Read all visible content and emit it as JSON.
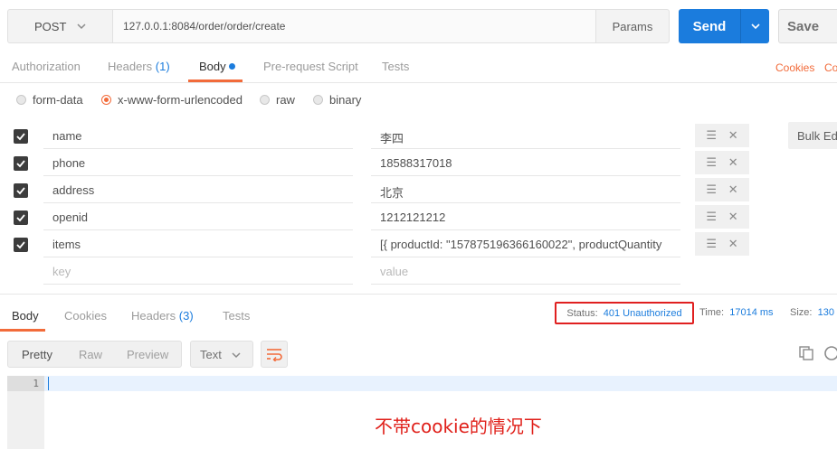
{
  "request": {
    "method": "POST",
    "url": "127.0.0.1:8084/order/order/create",
    "params_label": "Params",
    "send_label": "Send",
    "save_label": "Save"
  },
  "request_tabs": {
    "authorization": "Authorization",
    "headers": "Headers",
    "headers_count": "(1)",
    "body": "Body",
    "prerequest": "Pre-request Script",
    "tests": "Tests",
    "cookies": "Cookies",
    "code": "Co"
  },
  "body_types": [
    "form-data",
    "x-www-form-urlencoded",
    "raw",
    "binary"
  ],
  "body_type_selected": "x-www-form-urlencoded",
  "form_rows": [
    {
      "checked": true,
      "key": "name",
      "value": "李四"
    },
    {
      "checked": true,
      "key": "phone",
      "value": "18588317018"
    },
    {
      "checked": true,
      "key": "address",
      "value": "北京"
    },
    {
      "checked": true,
      "key": "openid",
      "value": "1212121212"
    },
    {
      "checked": true,
      "key": "items",
      "value": "[{ productId: \"157875196366160022\", productQuantity"
    }
  ],
  "new_row": {
    "key_placeholder": "key",
    "value_placeholder": "value"
  },
  "bulk_edit_label": "Bulk Edi",
  "response_tabs": {
    "body": "Body",
    "cookies": "Cookies",
    "headers": "Headers",
    "headers_count": "(3)",
    "tests": "Tests"
  },
  "response_meta": {
    "status_label": "Status:",
    "status_value": "401 Unauthorized",
    "time_label": "Time:",
    "time_value": "17014 ms",
    "size_label": "Size:",
    "size_value": "130 I"
  },
  "response_toolbar": {
    "views": [
      "Pretty",
      "Raw",
      "Preview"
    ],
    "selected_view": "Pretty",
    "format": "Text"
  },
  "editor": {
    "line_number": "1"
  },
  "annotation": "不带cookie的情况下",
  "colors": {
    "accent_orange": "#f26b3a",
    "send_blue": "#1b7cdd",
    "highlight_red": "#e02020"
  }
}
